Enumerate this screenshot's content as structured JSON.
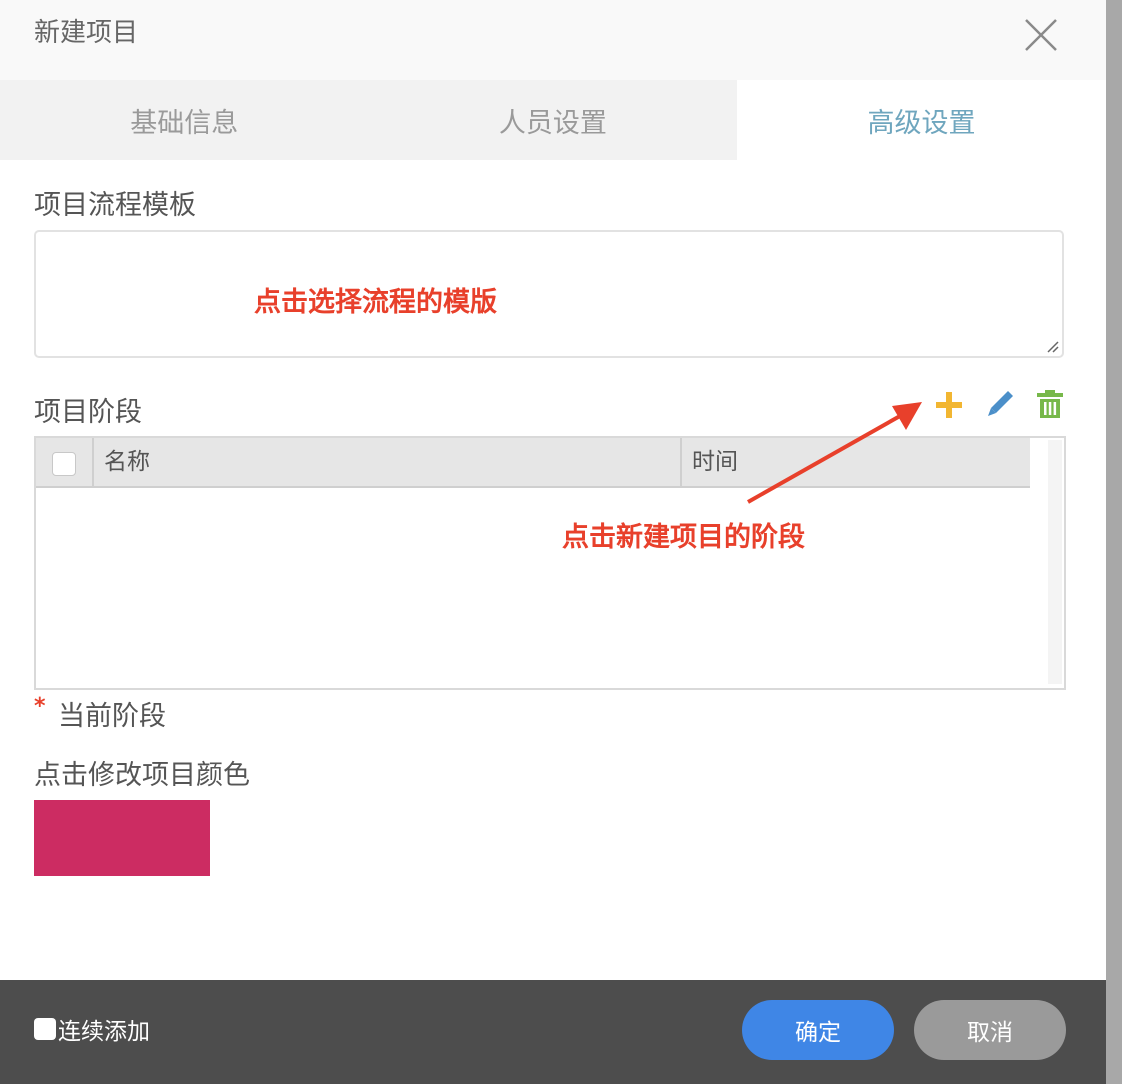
{
  "dialog": {
    "title": "新建项目"
  },
  "tabs": [
    {
      "label": "基础信息",
      "active": false
    },
    {
      "label": "人员设置",
      "active": false
    },
    {
      "label": "高级设置",
      "active": true
    }
  ],
  "template_section": {
    "label": "项目流程模板",
    "annotation": "点击选择流程的模版"
  },
  "stage_section": {
    "label": "项目阶段",
    "toolbar": {
      "add_icon": "plus-icon",
      "edit_icon": "pencil-icon",
      "delete_icon": "trash-icon"
    },
    "columns": [
      "名称",
      "时间"
    ],
    "rows": [],
    "annotation": "点击新建项目的阶段"
  },
  "current_stage": {
    "required_mark": "*",
    "label": "当前阶段"
  },
  "color_section": {
    "label": "点击修改项目颜色",
    "color": "#cc2c62"
  },
  "footer": {
    "continuous_add_label": "连续添加",
    "confirm_label": "确定",
    "cancel_label": "取消"
  },
  "colors": {
    "annotation": "#e8402b",
    "active_tab": "#6fa6be",
    "add_icon": "#f2b632",
    "edit_icon": "#4b8fc9",
    "delete_icon": "#77b84a",
    "confirm_button": "#3f86e6",
    "cancel_button": "#9a9a9a"
  }
}
